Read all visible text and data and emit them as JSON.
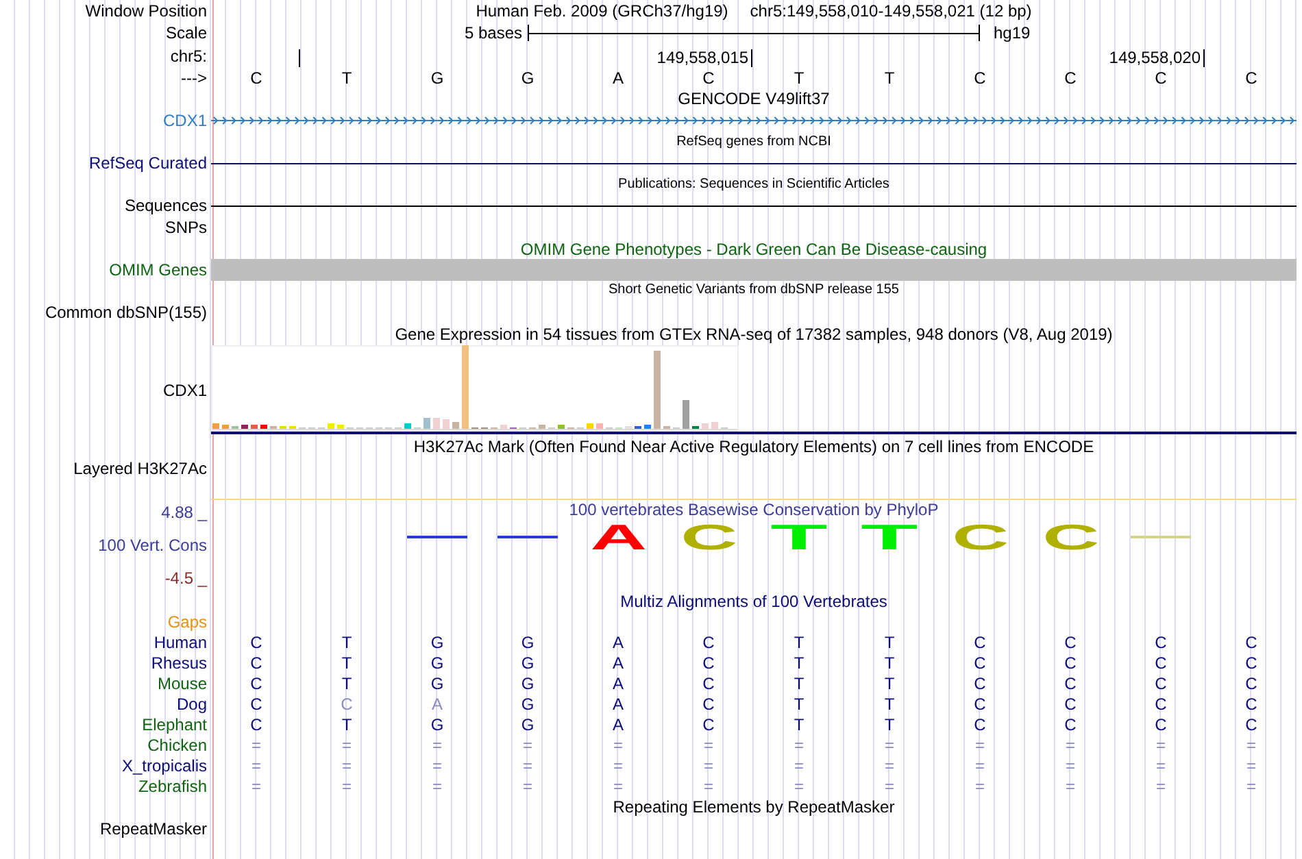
{
  "header": {
    "position_label": "Window Position",
    "assembly": "Human Feb. 2009 (GRCh37/hg19)",
    "position": "chr5:149,558,010-149,558,021 (12 bp)",
    "scale_label": "Scale",
    "scale_length": "5 bases",
    "scale_assembly": "hg19",
    "chrom_label": "chr5:",
    "strand_label": "--->",
    "bases": [
      {
        "base": "C",
        "tick": true
      },
      {
        "base": "T",
        "tick": false
      },
      {
        "base": "G",
        "tick": false
      },
      {
        "base": "G",
        "tick": false
      },
      {
        "base": "A",
        "tick": false
      },
      {
        "base": "C",
        "tick": true,
        "tick_label": "149,558,015"
      },
      {
        "base": "T",
        "tick": false
      },
      {
        "base": "T",
        "tick": false
      },
      {
        "base": "C",
        "tick": false
      },
      {
        "base": "C",
        "tick": false
      },
      {
        "base": "C",
        "tick": true,
        "tick_label": "149,558,020"
      },
      {
        "base": "C",
        "tick": false
      }
    ]
  },
  "tracks": [
    {
      "kind": "gene",
      "title": "GENCODE V49lift37",
      "label": "CDX1",
      "color": "#2f7dc3"
    },
    {
      "kind": "line",
      "title": "RefSeq genes from NCBI",
      "label": "RefSeq Curated",
      "color": "#0c0c78"
    },
    {
      "kind": "line",
      "title": "Publications: Sequences in Scientific Articles",
      "label": "Sequences",
      "color": "#000000"
    },
    {
      "kind": "plain",
      "label": "SNPs",
      "color": "#000000"
    },
    {
      "kind": "bar",
      "title": "OMIM Gene Phenotypes - Dark Green Can Be Disease-causing",
      "label": "OMIM Genes",
      "color": "#0f640f"
    },
    {
      "kind": "variants",
      "title": "Short Genetic Variants from dbSNP release 155",
      "label": "Common dbSNP(155)",
      "color": "#000000"
    },
    {
      "kind": "expression",
      "title": "Gene Expression in 54 tissues from GTEx RNA-seq of 17382 samples, 948 donors (V8, Aug 2019)",
      "label": "CDX1",
      "color": "#000000"
    },
    {
      "kind": "signal",
      "title": "H3K27Ac Mark (Often Found Near Active Regulatory Elements) on 7 cell lines from ENCODE",
      "label": "Layered H3K27Ac",
      "color": "#000000"
    },
    {
      "kind": "conservation",
      "title": "100 vertebrates Basewise Conservation by PhyloP",
      "label": "100 Vert. Cons",
      "color": "#3c3c96",
      "axis_max": "4.88 _",
      "axis_min": "-4.5 _",
      "logo": [
        {
          "kind": "none"
        },
        {
          "kind": "none"
        },
        {
          "kind": "dash",
          "color": "#2a3cd8"
        },
        {
          "kind": "dash",
          "color": "#2a3cd8"
        },
        {
          "kind": "letter",
          "letter": "A",
          "color": "#ff0000"
        },
        {
          "kind": "letter",
          "letter": "C",
          "color": "#b0b000"
        },
        {
          "kind": "letter",
          "letter": "T",
          "color": "#00ee00"
        },
        {
          "kind": "letter",
          "letter": "T",
          "color": "#00ee00"
        },
        {
          "kind": "letter",
          "letter": "C",
          "color": "#b0b000"
        },
        {
          "kind": "letter",
          "letter": "C",
          "color": "#b0b000"
        },
        {
          "kind": "dash",
          "color": "#d4d48c"
        },
        {
          "kind": "none"
        }
      ]
    },
    {
      "kind": "alignment",
      "title": "Multiz Alignments of 100 Vertebrates",
      "gaps_label": "Gaps",
      "color": "#e8900f",
      "species": [
        {
          "name": "Human",
          "color": "#0c0c78",
          "bases": [
            {
              "text": "C",
              "faded": false
            },
            {
              "text": "T",
              "faded": false
            },
            {
              "text": "G",
              "faded": false
            },
            {
              "text": "G",
              "faded": false
            },
            {
              "text": "A",
              "faded": false
            },
            {
              "text": "C",
              "faded": false
            },
            {
              "text": "T",
              "faded": false
            },
            {
              "text": "T",
              "faded": false
            },
            {
              "text": "C",
              "faded": false
            },
            {
              "text": "C",
              "faded": false
            },
            {
              "text": "C",
              "faded": false
            },
            {
              "text": "C",
              "faded": false
            }
          ]
        },
        {
          "name": "Rhesus",
          "color": "#0c0c78",
          "bases": [
            {
              "text": "C",
              "faded": false
            },
            {
              "text": "T",
              "faded": false
            },
            {
              "text": "G",
              "faded": false
            },
            {
              "text": "G",
              "faded": false
            },
            {
              "text": "A",
              "faded": false
            },
            {
              "text": "C",
              "faded": false
            },
            {
              "text": "T",
              "faded": false
            },
            {
              "text": "T",
              "faded": false
            },
            {
              "text": "C",
              "faded": false
            },
            {
              "text": "C",
              "faded": false
            },
            {
              "text": "C",
              "faded": false
            },
            {
              "text": "C",
              "faded": false
            }
          ]
        },
        {
          "name": "Mouse",
          "color": "#0f640f",
          "bases": [
            {
              "text": "C",
              "faded": false
            },
            {
              "text": "T",
              "faded": false
            },
            {
              "text": "G",
              "faded": false
            },
            {
              "text": "G",
              "faded": false
            },
            {
              "text": "A",
              "faded": false
            },
            {
              "text": "C",
              "faded": false
            },
            {
              "text": "T",
              "faded": false
            },
            {
              "text": "T",
              "faded": false
            },
            {
              "text": "C",
              "faded": false
            },
            {
              "text": "C",
              "faded": false
            },
            {
              "text": "C",
              "faded": false
            },
            {
              "text": "C",
              "faded": false
            }
          ]
        },
        {
          "name": "Dog",
          "color": "#0c0c78",
          "bases": [
            {
              "text": "C",
              "faded": false
            },
            {
              "text": "C",
              "faded": true
            },
            {
              "text": "A",
              "faded": true
            },
            {
              "text": "G",
              "faded": false
            },
            {
              "text": "A",
              "faded": false
            },
            {
              "text": "C",
              "faded": false
            },
            {
              "text": "T",
              "faded": false
            },
            {
              "text": "T",
              "faded": false
            },
            {
              "text": "C",
              "faded": false
            },
            {
              "text": "C",
              "faded": false
            },
            {
              "text": "C",
              "faded": false
            },
            {
              "text": "C",
              "faded": false
            }
          ]
        },
        {
          "name": "Elephant",
          "color": "#0f640f",
          "bases": [
            {
              "text": "C",
              "faded": false
            },
            {
              "text": "T",
              "faded": false
            },
            {
              "text": "G",
              "faded": false
            },
            {
              "text": "G",
              "faded": false
            },
            {
              "text": "A",
              "faded": false
            },
            {
              "text": "C",
              "faded": false
            },
            {
              "text": "T",
              "faded": false
            },
            {
              "text": "T",
              "faded": false
            },
            {
              "text": "C",
              "faded": false
            },
            {
              "text": "C",
              "faded": false
            },
            {
              "text": "C",
              "faded": false
            },
            {
              "text": "C",
              "faded": false
            }
          ]
        },
        {
          "name": "Chicken",
          "color": "#0f640f",
          "bases": [
            {
              "text": "=",
              "faded": true
            },
            {
              "text": "=",
              "faded": true
            },
            {
              "text": "=",
              "faded": true
            },
            {
              "text": "=",
              "faded": true
            },
            {
              "text": "=",
              "faded": true
            },
            {
              "text": "=",
              "faded": true
            },
            {
              "text": "=",
              "faded": true
            },
            {
              "text": "=",
              "faded": true
            },
            {
              "text": "=",
              "faded": true
            },
            {
              "text": "=",
              "faded": true
            },
            {
              "text": "=",
              "faded": true
            },
            {
              "text": "=",
              "faded": true
            }
          ]
        },
        {
          "name": "X_tropicalis",
          "color": "#0c0c78",
          "bases": [
            {
              "text": "=",
              "faded": true
            },
            {
              "text": "=",
              "faded": true
            },
            {
              "text": "=",
              "faded": true
            },
            {
              "text": "=",
              "faded": true
            },
            {
              "text": "=",
              "faded": true
            },
            {
              "text": "=",
              "faded": true
            },
            {
              "text": "=",
              "faded": true
            },
            {
              "text": "=",
              "faded": true
            },
            {
              "text": "=",
              "faded": true
            },
            {
              "text": "=",
              "faded": true
            },
            {
              "text": "=",
              "faded": true
            },
            {
              "text": "=",
              "faded": true
            }
          ]
        },
        {
          "name": "Zebrafish",
          "color": "#0f640f",
          "bases": [
            {
              "text": "=",
              "faded": true
            },
            {
              "text": "=",
              "faded": true
            },
            {
              "text": "=",
              "faded": true
            },
            {
              "text": "=",
              "faded": true
            },
            {
              "text": "=",
              "faded": true
            },
            {
              "text": "=",
              "faded": true
            },
            {
              "text": "=",
              "faded": true
            },
            {
              "text": "=",
              "faded": true
            },
            {
              "text": "=",
              "faded": true
            },
            {
              "text": "=",
              "faded": true
            },
            {
              "text": "=",
              "faded": true
            },
            {
              "text": "=",
              "faded": true
            }
          ]
        }
      ]
    },
    {
      "kind": "repeats",
      "title": "Repeating Elements by RepeatMasker",
      "label": "RepeatMasker",
      "color": "#000000"
    }
  ]
}
